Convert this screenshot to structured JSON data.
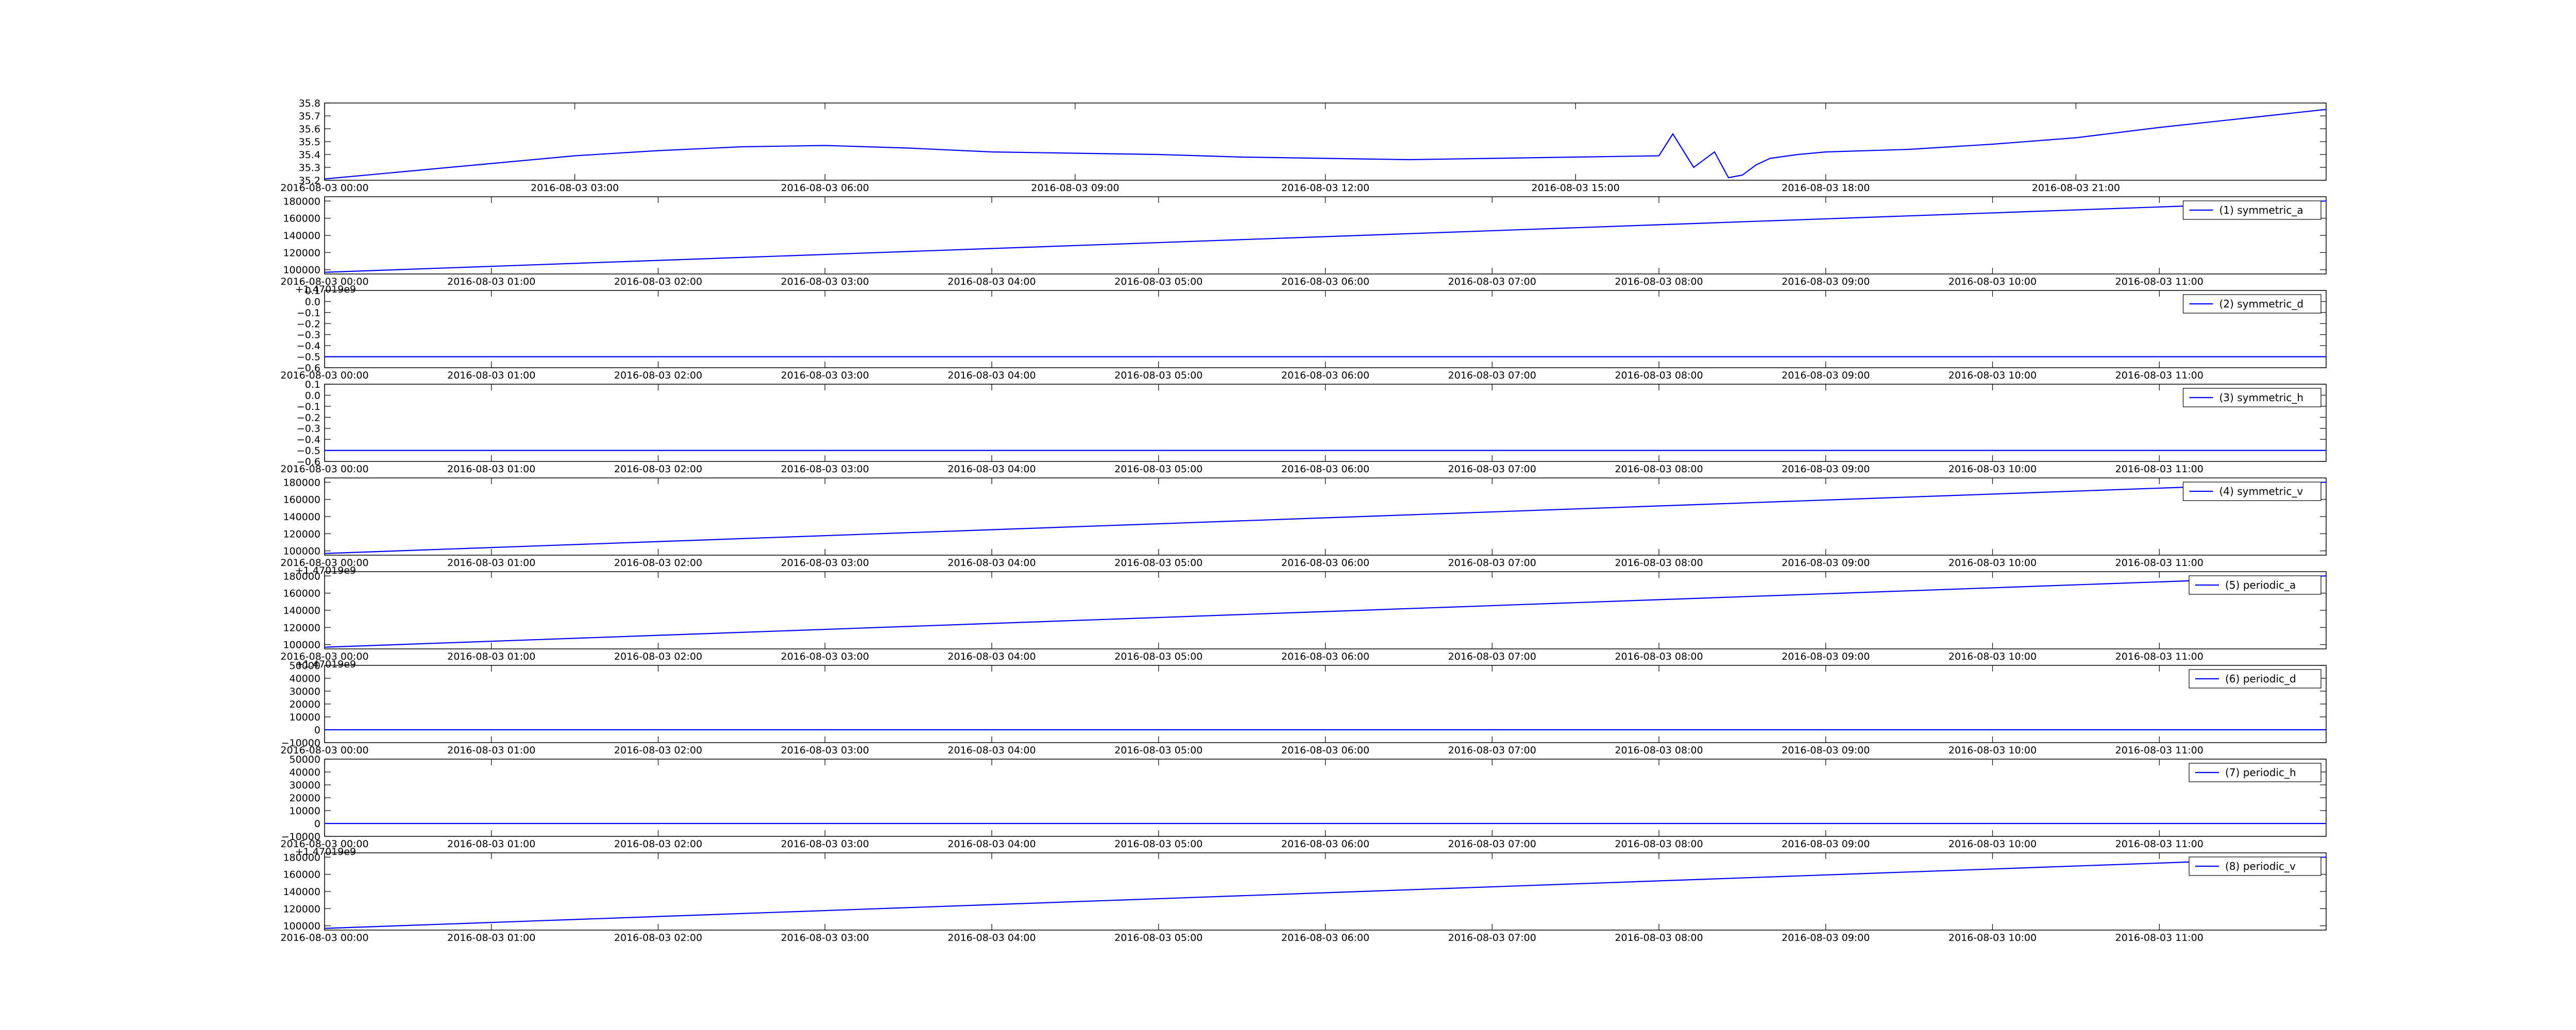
{
  "figure": {
    "line_color": "#0000ff",
    "background": "#ffffff"
  },
  "chart_data": [
    {
      "type": "line",
      "id": "p0",
      "title": "",
      "xlabel": "",
      "ylabel": "",
      "legend": null,
      "offset_text": "",
      "x_ticks": [
        "2016-08-03 00:00",
        "2016-08-03 03:00",
        "2016-08-03 06:00",
        "2016-08-03 09:00",
        "2016-08-03 12:00",
        "2016-08-03 15:00",
        "2016-08-03 18:00",
        "2016-08-03 21:00"
      ],
      "x_range": [
        "2016-08-03 00:00",
        "2016-08-04 00:00"
      ],
      "y_ticks": [
        "35.2",
        "35.3",
        "35.4",
        "35.5",
        "35.6",
        "35.7",
        "35.8"
      ],
      "ylim": [
        35.2,
        35.8
      ],
      "series": [
        {
          "x": [
            "2016-08-03 00:00",
            "2016-08-03 01:00",
            "2016-08-03 02:00",
            "2016-08-03 03:00",
            "2016-08-03 04:00",
            "2016-08-03 05:00",
            "2016-08-03 06:00",
            "2016-08-03 07:00",
            "2016-08-03 08:00",
            "2016-08-03 09:00",
            "2016-08-03 10:00",
            "2016-08-03 11:00",
            "2016-08-03 12:00",
            "2016-08-03 13:00",
            "2016-08-03 14:00",
            "2016-08-03 15:00",
            "2016-08-03 16:00",
            "2016-08-03 16:10",
            "2016-08-03 16:25",
            "2016-08-03 16:40",
            "2016-08-03 16:50",
            "2016-08-03 17:00",
            "2016-08-03 17:10",
            "2016-08-03 17:20",
            "2016-08-03 17:40",
            "2016-08-03 18:00",
            "2016-08-03 19:00",
            "2016-08-03 20:00",
            "2016-08-03 21:00",
            "2016-08-03 22:00",
            "2016-08-03 23:00",
            "2016-08-04 00:00"
          ],
          "values": [
            35.21,
            35.27,
            35.33,
            35.39,
            35.43,
            35.46,
            35.47,
            35.45,
            35.42,
            35.41,
            35.4,
            35.38,
            35.37,
            35.36,
            35.37,
            35.38,
            35.39,
            35.56,
            35.3,
            35.42,
            35.22,
            35.24,
            35.32,
            35.37,
            35.4,
            35.42,
            35.44,
            35.48,
            35.53,
            35.61,
            35.68,
            35.75
          ]
        }
      ]
    },
    {
      "type": "line",
      "id": "p1",
      "legend": "(1) symmetric_a",
      "offset_text": "+1.47019e9",
      "x_ticks": [
        "2016-08-03 00:00",
        "2016-08-03 01:00",
        "2016-08-03 02:00",
        "2016-08-03 03:00",
        "2016-08-03 04:00",
        "2016-08-03 05:00",
        "2016-08-03 06:00",
        "2016-08-03 07:00",
        "2016-08-03 08:00",
        "2016-08-03 09:00",
        "2016-08-03 10:00",
        "2016-08-03 11:00"
      ],
      "x_range": [
        "2016-08-03 00:00",
        "2016-08-03 12:00"
      ],
      "y_ticks": [
        "100000",
        "120000",
        "140000",
        "160000",
        "180000"
      ],
      "ylim": [
        95000,
        185000
      ],
      "series": [
        {
          "x": [
            "2016-08-03 00:00",
            "2016-08-03 12:00"
          ],
          "values": [
            97000,
            180000
          ]
        }
      ]
    },
    {
      "type": "line",
      "id": "p2",
      "legend": "(2) symmetric_d",
      "offset_text": "",
      "x_ticks": [
        "2016-08-03 00:00",
        "2016-08-03 01:00",
        "2016-08-03 02:00",
        "2016-08-03 03:00",
        "2016-08-03 04:00",
        "2016-08-03 05:00",
        "2016-08-03 06:00",
        "2016-08-03 07:00",
        "2016-08-03 08:00",
        "2016-08-03 09:00",
        "2016-08-03 10:00",
        "2016-08-03 11:00"
      ],
      "x_range": [
        "2016-08-03 00:00",
        "2016-08-03 12:00"
      ],
      "y_ticks": [
        "−0.6",
        "−0.5",
        "−0.4",
        "−0.3",
        "−0.2",
        "−0.1",
        "0.0",
        "0.1"
      ],
      "ylim": [
        -0.6,
        0.1
      ],
      "series": [
        {
          "x": [
            "2016-08-03 00:00",
            "2016-08-03 12:00"
          ],
          "values": [
            -0.5,
            -0.5
          ]
        }
      ]
    },
    {
      "type": "line",
      "id": "p3",
      "legend": "(3) symmetric_h",
      "offset_text": "",
      "x_ticks": [
        "2016-08-03 00:00",
        "2016-08-03 01:00",
        "2016-08-03 02:00",
        "2016-08-03 03:00",
        "2016-08-03 04:00",
        "2016-08-03 05:00",
        "2016-08-03 06:00",
        "2016-08-03 07:00",
        "2016-08-03 08:00",
        "2016-08-03 09:00",
        "2016-08-03 10:00",
        "2016-08-03 11:00"
      ],
      "x_range": [
        "2016-08-03 00:00",
        "2016-08-03 12:00"
      ],
      "y_ticks": [
        "−0.6",
        "−0.5",
        "−0.4",
        "−0.3",
        "−0.2",
        "−0.1",
        "0.0",
        "0.1"
      ],
      "ylim": [
        -0.6,
        0.1
      ],
      "series": [
        {
          "x": [
            "2016-08-03 00:00",
            "2016-08-03 12:00"
          ],
          "values": [
            -0.5,
            -0.5
          ]
        }
      ]
    },
    {
      "type": "line",
      "id": "p4",
      "legend": "(4) symmetric_v",
      "offset_text": "+1.47019e9",
      "x_ticks": [
        "2016-08-03 00:00",
        "2016-08-03 01:00",
        "2016-08-03 02:00",
        "2016-08-03 03:00",
        "2016-08-03 04:00",
        "2016-08-03 05:00",
        "2016-08-03 06:00",
        "2016-08-03 07:00",
        "2016-08-03 08:00",
        "2016-08-03 09:00",
        "2016-08-03 10:00",
        "2016-08-03 11:00"
      ],
      "x_range": [
        "2016-08-03 00:00",
        "2016-08-03 12:00"
      ],
      "y_ticks": [
        "100000",
        "120000",
        "140000",
        "160000",
        "180000"
      ],
      "ylim": [
        95000,
        185000
      ],
      "series": [
        {
          "x": [
            "2016-08-03 00:00",
            "2016-08-03 12:00"
          ],
          "values": [
            97000,
            180000
          ]
        }
      ]
    },
    {
      "type": "line",
      "id": "p5",
      "legend": "(5) periodic_a",
      "offset_text": "+1.47019e9",
      "x_ticks": [
        "2016-08-03 00:00",
        "2016-08-03 01:00",
        "2016-08-03 02:00",
        "2016-08-03 03:00",
        "2016-08-03 04:00",
        "2016-08-03 05:00",
        "2016-08-03 06:00",
        "2016-08-03 07:00",
        "2016-08-03 08:00",
        "2016-08-03 09:00",
        "2016-08-03 10:00",
        "2016-08-03 11:00"
      ],
      "x_range": [
        "2016-08-03 00:00",
        "2016-08-03 12:00"
      ],
      "y_ticks": [
        "100000",
        "120000",
        "140000",
        "160000",
        "180000"
      ],
      "ylim": [
        95000,
        185000
      ],
      "series": [
        {
          "x": [
            "2016-08-03 00:00",
            "2016-08-03 12:00"
          ],
          "values": [
            97000,
            180000
          ]
        }
      ]
    },
    {
      "type": "line",
      "id": "p6",
      "legend": "(6) periodic_d",
      "offset_text": "",
      "x_ticks": [
        "2016-08-03 00:00",
        "2016-08-03 01:00",
        "2016-08-03 02:00",
        "2016-08-03 03:00",
        "2016-08-03 04:00",
        "2016-08-03 05:00",
        "2016-08-03 06:00",
        "2016-08-03 07:00",
        "2016-08-03 08:00",
        "2016-08-03 09:00",
        "2016-08-03 10:00",
        "2016-08-03 11:00"
      ],
      "x_range": [
        "2016-08-03 00:00",
        "2016-08-03 12:00"
      ],
      "y_ticks": [
        "−10000",
        "0",
        "10000",
        "20000",
        "30000",
        "40000",
        "50000"
      ],
      "ylim": [
        -10000,
        50000
      ],
      "series": [
        {
          "x": [
            "2016-08-03 00:00",
            "2016-08-03 12:00"
          ],
          "values": [
            0,
            0
          ]
        }
      ]
    },
    {
      "type": "line",
      "id": "p7",
      "legend": "(7) periodic_h",
      "offset_text": "+1.47019e9",
      "x_ticks": [
        "2016-08-03 00:00",
        "2016-08-03 01:00",
        "2016-08-03 02:00",
        "2016-08-03 03:00",
        "2016-08-03 04:00",
        "2016-08-03 05:00",
        "2016-08-03 06:00",
        "2016-08-03 07:00",
        "2016-08-03 08:00",
        "2016-08-03 09:00",
        "2016-08-03 10:00",
        "2016-08-03 11:00"
      ],
      "x_range": [
        "2016-08-03 00:00",
        "2016-08-03 12:00"
      ],
      "y_ticks": [
        "−10000",
        "0",
        "10000",
        "20000",
        "30000",
        "40000",
        "50000"
      ],
      "ylim": [
        -10000,
        50000
      ],
      "series": [
        {
          "x": [
            "2016-08-03 00:00",
            "2016-08-03 12:00"
          ],
          "values": [
            0,
            0
          ]
        }
      ]
    },
    {
      "type": "line",
      "id": "p8",
      "legend": "(8) periodic_v",
      "offset_text": "",
      "x_ticks": [
        "2016-08-03 00:00",
        "2016-08-03 01:00",
        "2016-08-03 02:00",
        "2016-08-03 03:00",
        "2016-08-03 04:00",
        "2016-08-03 05:00",
        "2016-08-03 06:00",
        "2016-08-03 07:00",
        "2016-08-03 08:00",
        "2016-08-03 09:00",
        "2016-08-03 10:00",
        "2016-08-03 11:00"
      ],
      "x_range": [
        "2016-08-03 00:00",
        "2016-08-03 12:00"
      ],
      "y_ticks": [
        "100000",
        "120000",
        "140000",
        "160000",
        "180000"
      ],
      "ylim": [
        95000,
        185000
      ],
      "series": [
        {
          "x": [
            "2016-08-03 00:00",
            "2016-08-03 12:00"
          ],
          "values": [
            97000,
            180000
          ]
        }
      ]
    }
  ]
}
